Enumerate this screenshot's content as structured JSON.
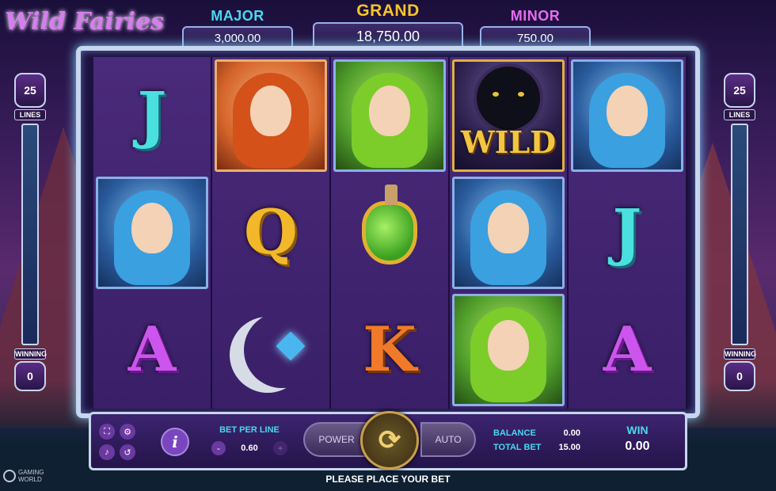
{
  "game": {
    "logo_text": "Wild Fairies",
    "brand_line1": "GAMING",
    "brand_line2": "WORLD"
  },
  "jackpots": {
    "major": {
      "label": "MAJOR",
      "value": "3,000.00"
    },
    "grand": {
      "label": "GRAND",
      "value": "18,750.00"
    },
    "minor": {
      "label": "MINOR",
      "value": "750.00"
    }
  },
  "lines_meter": {
    "lines_value": "25",
    "lines_label": "LINES",
    "winning_label": "WINNING",
    "winning_value": "0"
  },
  "reels": [
    [
      "J",
      "fairy-blue",
      "A"
    ],
    [
      "fairy-red",
      "Q",
      "moon"
    ],
    [
      "fairy-green",
      "potion",
      "K"
    ],
    [
      "wild",
      "fairy-blue",
      "fairy-green"
    ],
    [
      "fairy-blue",
      "J",
      "A"
    ]
  ],
  "wild_text": "WILD",
  "letters": {
    "J": "J",
    "Q": "Q",
    "K": "K",
    "A": "A"
  },
  "controls": {
    "info_label": "i",
    "bet_per_line_label": "BET PER LINE",
    "bet_per_line_value": "0.60",
    "minus_label": "-",
    "plus_label": "+",
    "power_label": "POWER",
    "auto_label": "AUTO",
    "spin_icon": "⟳",
    "balance_label": "BALANCE",
    "balance_value": "0.00",
    "total_bet_label": "TOTAL BET",
    "total_bet_value": "15.00",
    "win_label": "WIN",
    "win_value": "0.00"
  },
  "status_message": "PLEASE PLACE YOUR BET",
  "icons": {
    "fullscreen": "fullscreen-icon",
    "settings": "gear-icon",
    "sound": "sound-icon",
    "history": "history-icon"
  },
  "colors": {
    "accent_cyan": "#4ad9f0",
    "grand_gold": "#f6c52a",
    "minor_pink": "#e66cf0",
    "frame": "#c7d6ee"
  }
}
